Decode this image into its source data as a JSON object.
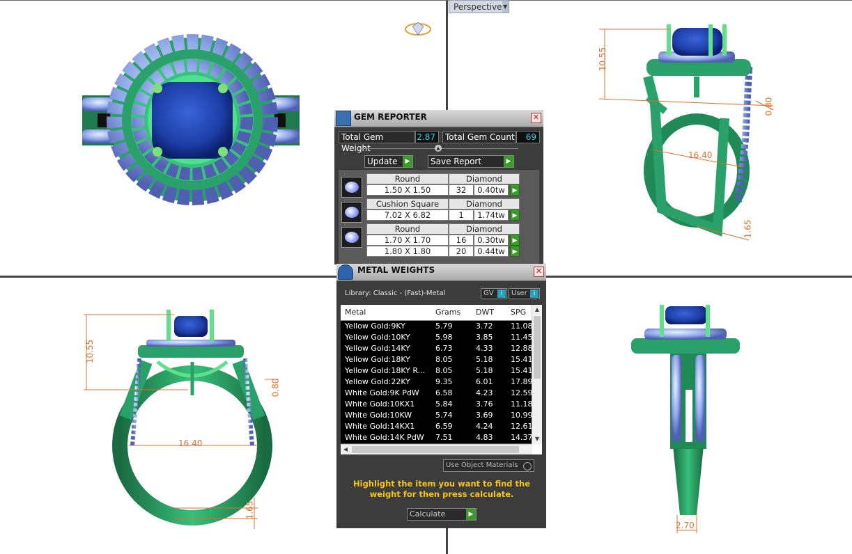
{
  "viewport": {
    "label": "Perspective"
  },
  "dimensions": {
    "tr_height": "10.55",
    "tr_width": "16.40",
    "tr_gap": "0.80",
    "tr_band": "1.65",
    "bl_height": "10.55",
    "bl_width": "16.40",
    "bl_gap": "0.80",
    "bl_band": "1.65",
    "br_shank": "2.70"
  },
  "gem_reporter": {
    "title": "GEM REPORTER",
    "total_weight_label": "Total Gem Weight",
    "total_weight_value": "2.87",
    "total_count_label": "Total Gem Count",
    "total_count_value": "69",
    "update_label": "Update",
    "save_report_label": "Save Report",
    "groups": [
      {
        "shape": "Round",
        "type": "Diamond",
        "rows": [
          {
            "size": "1.50 X 1.50",
            "count": "32",
            "weight": "0.40tw"
          }
        ]
      },
      {
        "shape": "Cushion Square",
        "type": "Diamond",
        "rows": [
          {
            "size": "7.02 X 6.82",
            "count": "1",
            "weight": "1.74tw"
          }
        ]
      },
      {
        "shape": "Round",
        "type": "Diamond",
        "rows": [
          {
            "size": "1.70 X 1.70",
            "count": "16",
            "weight": "0.30tw"
          },
          {
            "size": "1.80 X 1.80",
            "count": "20",
            "weight": "0.44tw"
          }
        ]
      }
    ]
  },
  "metal_weights": {
    "title": "METAL WEIGHTS",
    "library": "Library: Classic - (Fast)-Metal",
    "gv_label": "GV",
    "user_label": "User",
    "columns": [
      "Metal",
      "Grams",
      "DWT",
      "SPG"
    ],
    "rows": [
      [
        "Yellow Gold:9KY",
        "5.79",
        "3.72",
        "11.08"
      ],
      [
        "Yellow Gold:10KY",
        "5.98",
        "3.85",
        "11.45"
      ],
      [
        "Yellow Gold:14KY",
        "6.73",
        "4.33",
        "12.88"
      ],
      [
        "Yellow Gold:18KY",
        "8.05",
        "5.18",
        "15.41"
      ],
      [
        "Yellow Gold:18KY R...",
        "8.05",
        "5.18",
        "15.41"
      ],
      [
        "Yellow Gold:22KY",
        "9.35",
        "6.01",
        "17.89"
      ],
      [
        "White Gold:9K PdW",
        "6.58",
        "4.23",
        "12.59"
      ],
      [
        "White Gold:10KX1",
        "5.84",
        "3.76",
        "11.18"
      ],
      [
        "White Gold:10KW",
        "5.74",
        "3.69",
        "10.99"
      ],
      [
        "White Gold:14KX1",
        "6.59",
        "4.24",
        "12.61"
      ],
      [
        "White Gold:14K PdW",
        "7.51",
        "4.83",
        "14.37"
      ]
    ],
    "use_object_label": "Use Object Materials",
    "hint": "Highlight the item you want to find the weight for then press calculate.",
    "calculate_label": "Calculate"
  }
}
